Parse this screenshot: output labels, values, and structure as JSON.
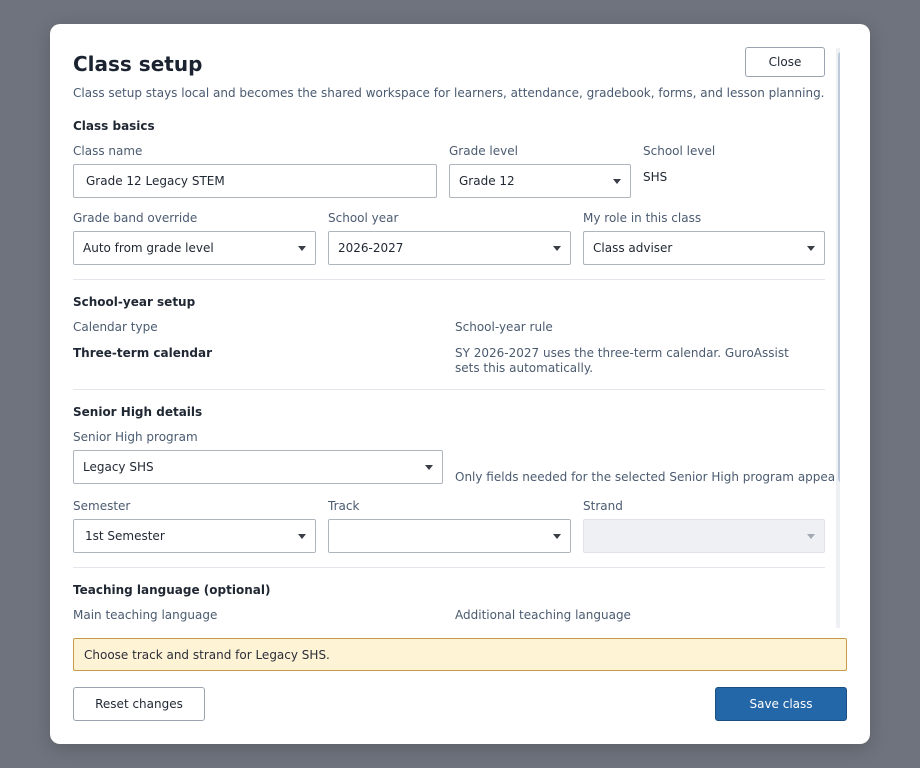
{
  "dialog": {
    "title": "Class setup",
    "close_label": "Close",
    "subtitle": "Class setup stays local and becomes the shared workspace for learners, attendance, gradebook, forms, and lesson planning."
  },
  "class_basics": {
    "heading": "Class basics",
    "class_name_label": "Class name",
    "class_name_value": "Grade 12 Legacy STEM",
    "grade_level_label": "Grade level",
    "grade_level_value": "Grade 12",
    "school_level_label": "School level",
    "school_level_value": "SHS",
    "grade_band_label": "Grade band override",
    "grade_band_value": "Auto from grade level",
    "school_year_label": "School year",
    "school_year_value": "2026-2027",
    "role_label": "My role in this class",
    "role_value": "Class adviser"
  },
  "school_year_setup": {
    "heading": "School-year setup",
    "calendar_type_label": "Calendar type",
    "calendar_type_value": "Three-term calendar",
    "rule_label": "School-year rule",
    "rule_text": "SY 2026-2027 uses the three-term calendar. GuroAssist sets this automatically."
  },
  "senior_high": {
    "heading": "Senior High details",
    "program_label": "Senior High program",
    "program_value": "Legacy SHS",
    "program_hint": "Only fields needed for the selected Senior High program appear here.",
    "semester_label": "Semester",
    "semester_value": "1st Semester",
    "track_label": "Track",
    "track_value": "",
    "strand_label": "Strand",
    "strand_value": ""
  },
  "teaching_language": {
    "heading": "Teaching language (optional)",
    "main_label": "Main teaching language",
    "additional_label": "Additional teaching language"
  },
  "alert": {
    "text": "Choose track and strand for Legacy SHS."
  },
  "footer": {
    "reset_label": "Reset changes",
    "save_label": "Save class"
  },
  "colors": {
    "backdrop": "#6f737d",
    "primary": "#2467a8",
    "alert_bg": "#fff3d6",
    "alert_border": "#c69b4a"
  },
  "icons": {
    "select_caret": "chevron-down-icon"
  }
}
